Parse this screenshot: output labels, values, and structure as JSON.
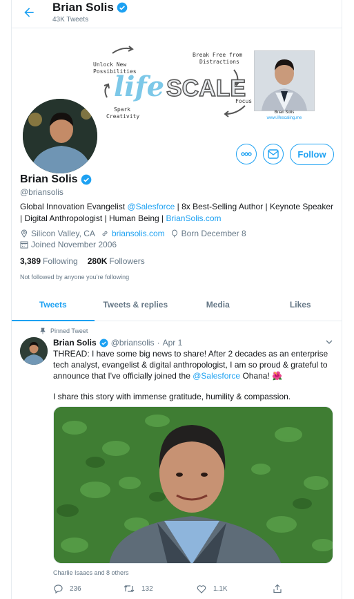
{
  "header": {
    "name": "Brian Solis",
    "tweet_count": "43K Tweets"
  },
  "banner": {
    "logo_part1": "life",
    "logo_part2": "SCALE",
    "phrases": {
      "unlock1": "Unlock New",
      "unlock2": "Possibilities",
      "break1": "Break Free from",
      "break2": "Distractions",
      "spark1": "Spark",
      "spark2": "Creativity",
      "focus": "Focus"
    },
    "photo_caption": "Brian Solis",
    "photo_url": "www.lifescaling.me"
  },
  "actions": {
    "follow_label": "Follow"
  },
  "profile": {
    "name": "Brian Solis",
    "handle": "@briansolis",
    "bio_1": "Global Innovation Evangelist ",
    "bio_mention": "@Salesforce",
    "bio_2": " | 8x Best-Selling Author | Keynote Speaker | Digital Anthropologist | Human Being | ",
    "bio_link": "BrianSolis.com",
    "location": "Silicon Valley, CA",
    "website": "briansolis.com",
    "birthday": "Born December 8",
    "joined": "Joined November 2006",
    "following_count": "3,389",
    "following_label": "Following",
    "followers_count": "280K",
    "followers_label": "Followers",
    "not_followed": "Not followed by anyone you’re following"
  },
  "tabs": [
    {
      "label": "Tweets",
      "active": true
    },
    {
      "label": "Tweets & replies",
      "active": false
    },
    {
      "label": "Media",
      "active": false
    },
    {
      "label": "Likes",
      "active": false
    }
  ],
  "tweet": {
    "pinned_label": "Pinned Tweet",
    "author": "Brian Solis",
    "handle": "@briansolis",
    "separator": "·",
    "date": "Apr 1",
    "text_1": "THREAD: I have some big news to share! After 2 decades as an enterprise tech analyst, evangelist & digital anthropologist, I am so proud & grateful to announce that I've officially joined the ",
    "text_mention": "@Salesforce",
    "text_2": " Ohana! 🌺",
    "text_para2": "I share this story with immense gratitude, humility & compassion.",
    "tagged": "Charlie Isaacs and 8 others",
    "reply_count": "236",
    "retweet_count": "132",
    "like_count": "1.1K"
  },
  "colors": {
    "accent": "#1da1f2",
    "secondary_text": "#657786",
    "border": "#e6ecf0"
  },
  "icons": [
    "back-arrow-icon",
    "verified-icon",
    "more-icon",
    "mail-icon",
    "location-icon",
    "link-icon",
    "balloon-icon",
    "calendar-icon",
    "pin-icon",
    "chevron-down-icon",
    "reply-icon",
    "retweet-icon",
    "like-icon",
    "share-icon"
  ]
}
